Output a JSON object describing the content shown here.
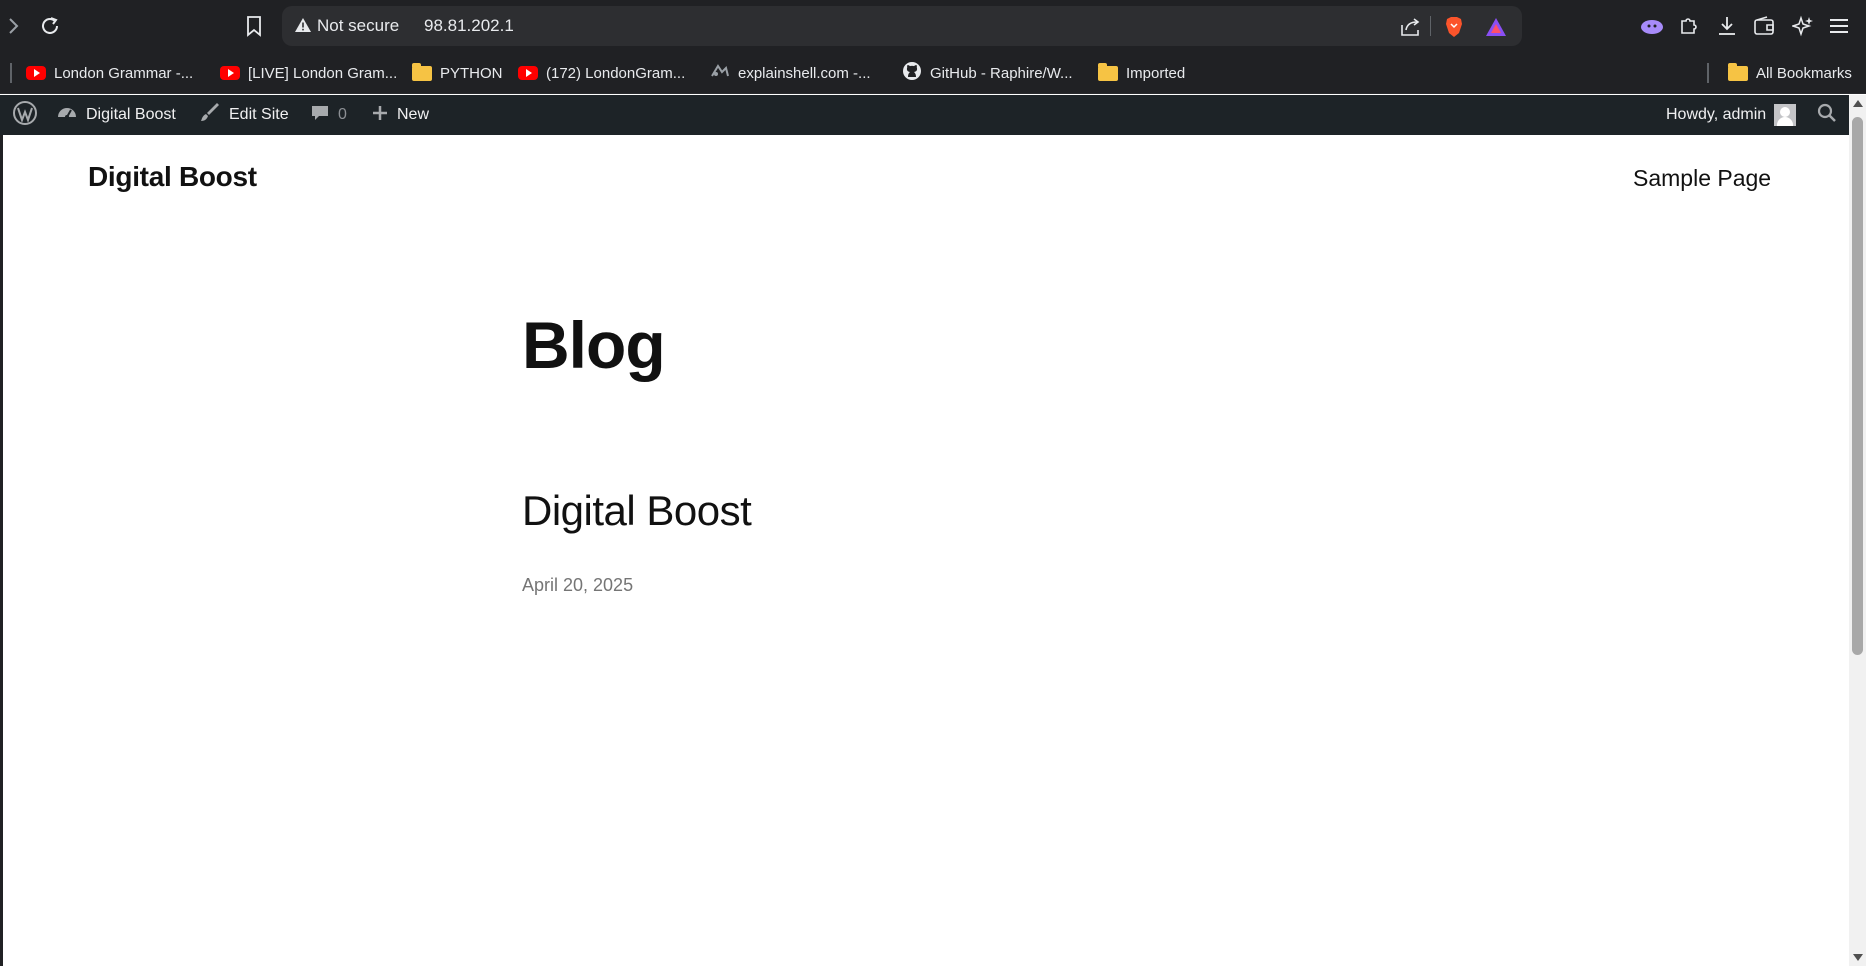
{
  "browser": {
    "address": {
      "security_label": "Not secure",
      "url": "98.81.202.1"
    },
    "bookmarks": [
      {
        "label": "London Grammar -...",
        "icon": "youtube-icon"
      },
      {
        "label": "[LIVE] London Gram...",
        "icon": "youtube-icon"
      },
      {
        "label": "PYTHON",
        "icon": "folder-icon"
      },
      {
        "label": "(172) LondonGram...",
        "icon": "youtube-icon"
      },
      {
        "label": "explainshell.com -...",
        "icon": "explainshell-icon"
      },
      {
        "label": "GitHub - Raphire/W...",
        "icon": "github-icon"
      },
      {
        "label": "Imported",
        "icon": "folder-icon"
      }
    ],
    "all_bookmarks_label": "All Bookmarks"
  },
  "admin_bar": {
    "site_name": "Digital Boost",
    "edit_site": "Edit Site",
    "comments_count": "0",
    "new_label": "New",
    "howdy": "Howdy, admin"
  },
  "site": {
    "title": "Digital Boost",
    "nav": [
      "Sample Page"
    ]
  },
  "main": {
    "heading": "Blog",
    "posts": [
      {
        "title": "Digital Boost",
        "date": "April 20, 2025"
      }
    ]
  },
  "colors": {
    "browser_chrome": "#202124",
    "admin_bar": "#1d2327",
    "page_background": "#ffffff",
    "text": "#111111",
    "date_text": "#757575"
  }
}
